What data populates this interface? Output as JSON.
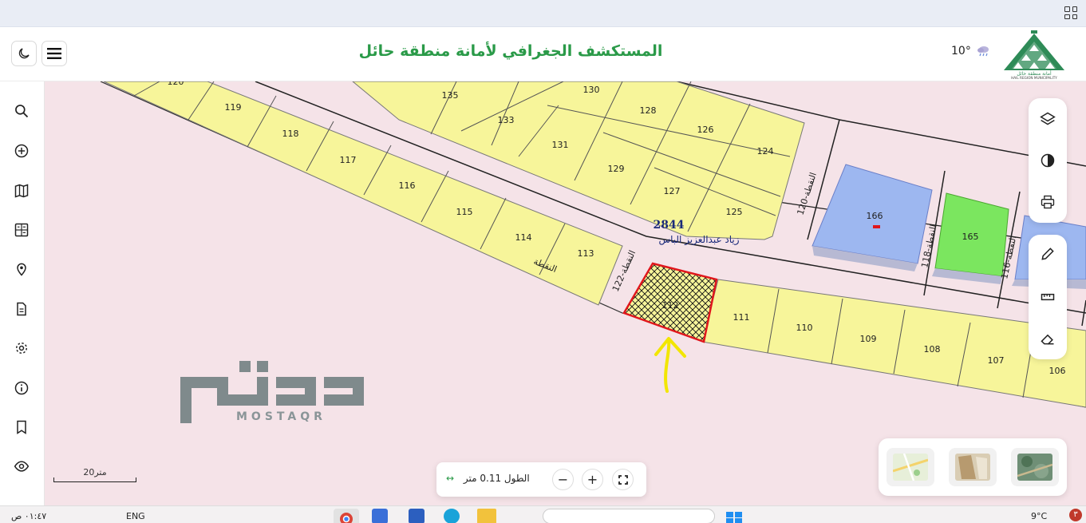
{
  "header": {
    "title": "المستكشف الجغرافي لأمانة منطقة حائل",
    "temperature": "10°",
    "logo_caption": "HAIL REGION MUNICIPALITY",
    "logo_caption_ar": "أمانة منطقة حائل"
  },
  "sidebar": {
    "items": [
      "search-icon",
      "add-circle-icon",
      "map-icon",
      "calculator-icon",
      "location-pin-icon",
      "document-icon",
      "gear-icon",
      "info-icon",
      "bookmark-icon",
      "eye-icon"
    ]
  },
  "map": {
    "parcels_top": [
      "135",
      "130",
      "128",
      "133",
      "126",
      "131",
      "124",
      "129",
      "127",
      "125"
    ],
    "parcels_row": [
      "120",
      "119",
      "118",
      "117",
      "116",
      "115",
      "114",
      "113"
    ],
    "parcels_bottom": [
      "111",
      "110",
      "109",
      "108",
      "107",
      "106"
    ],
    "selected_parcel": "112",
    "buildings": [
      "166",
      "165"
    ],
    "street_labels": [
      "النقطة-120",
      "النقطة-118",
      "النقطة-116",
      "النقطة-122",
      "النقطة"
    ],
    "block_number": "2844",
    "owner_name": "زياد عبدالعزيز الباس"
  },
  "watermark": {
    "arabic": "مستقر",
    "latin": "MOSTAQR"
  },
  "scale": {
    "label": "20متر"
  },
  "bottom_bar": {
    "length_text": "الطول 0.11 متر"
  },
  "taskbar": {
    "time": "٠١:٤٧ ص",
    "lang": "ENG",
    "weather": "9°C",
    "notif": "٣"
  },
  "colors": {
    "brand_green": "#2a9a48",
    "parcel_yellow": "#f7f59a",
    "building_blue": "#9db7f0",
    "building_green": "#7be65f",
    "selected_red": "#e0161c",
    "map_bg": "#f5e3e8"
  }
}
